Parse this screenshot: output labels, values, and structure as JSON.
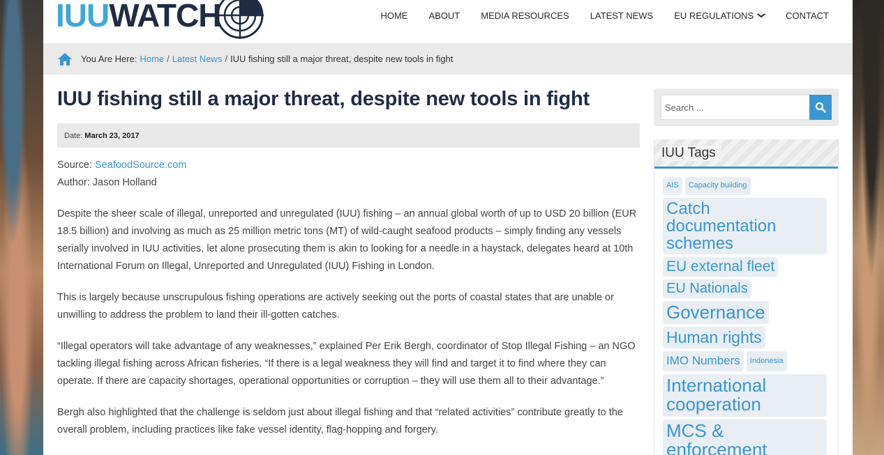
{
  "header": {
    "logo_part1": "IUU",
    "logo_part2": "WATCH",
    "nav": [
      {
        "label": "HOME"
      },
      {
        "label": "ABOUT"
      },
      {
        "label": "MEDIA RESOURCES"
      },
      {
        "label": "LATEST NEWS"
      },
      {
        "label": "EU REGULATIONS"
      },
      {
        "label": "CONTACT"
      }
    ]
  },
  "breadcrumb": {
    "prefix": "You Are Here:",
    "home": "Home",
    "latest": "Latest News",
    "current": "IUU fishing still a major threat, despite new tools in fight",
    "separator": "/"
  },
  "article": {
    "title": "IUU fishing still a major threat, despite new tools in fight",
    "date_label": "Date:",
    "date": "March 23, 2017",
    "source_label": "Source:",
    "source_link": "SeafoodSource.com",
    "author": "Author: Jason Holland",
    "paragraphs": [
      "Despite the sheer scale of illegal, unreported and unregulated (IUU) fishing – an annual global worth of up to USD 20 billion (EUR 18.5 billion) and involving as much as 25 million metric tons (MT) of wild-caught seafood products – simply finding any vessels serially involved in IUU activities, let alone prosecuting them is akin to looking for a needle in a haystack, delegates heard at 10th International Forum on Illegal, Unreported and Unregulated (IUU) Fishing in London.",
      "This is largely because unscrupulous fishing operations are actively seeking out the ports of coastal states that are unable or unwilling to address the problem to land their ill-gotten catches.",
      "“Illegal operators will take advantage of any weaknesses,” explained Per Erik Bergh, coordinator of Stop Illegal Fishing – an NGO tackling illegal fishing across African fisheries. “If there is a legal weakness they will find and target it to find where they can operate. If there are capacity shortages, operational opportunities or corruption – they will use them all to their advantage.”",
      "Bergh also highlighted that the challenge is seldom just about illegal fishing and that “related activities” contribute greatly to the overall problem, including practices like fake vessel identity, flag-hopping and forgery."
    ]
  },
  "sidebar": {
    "search_placeholder": "Search ...",
    "tags_title": "IUU Tags",
    "tags": [
      {
        "label": "AIS",
        "size": "small"
      },
      {
        "label": "Capacity building",
        "size": "small"
      },
      {
        "label": "Catch documentation schemes",
        "size": "xlarge"
      },
      {
        "label": "EU external fleet",
        "size": "large"
      },
      {
        "label": "EU Nationals",
        "size": "large"
      },
      {
        "label": "Governance",
        "size": "xlarge"
      },
      {
        "label": "Human rights",
        "size": "xlarge-"
      },
      {
        "label": "IMO Numbers",
        "size": "medium"
      },
      {
        "label": "Indonesia",
        "size": "small"
      },
      {
        "label": "International cooperation",
        "size": "xlarge"
      },
      {
        "label": "MCS & enforcement",
        "size": "xlarge"
      }
    ]
  },
  "colors": {
    "accent": "#3a96d0",
    "logo_light": "#41a6d8",
    "logo_dark": "#1f2c44"
  }
}
